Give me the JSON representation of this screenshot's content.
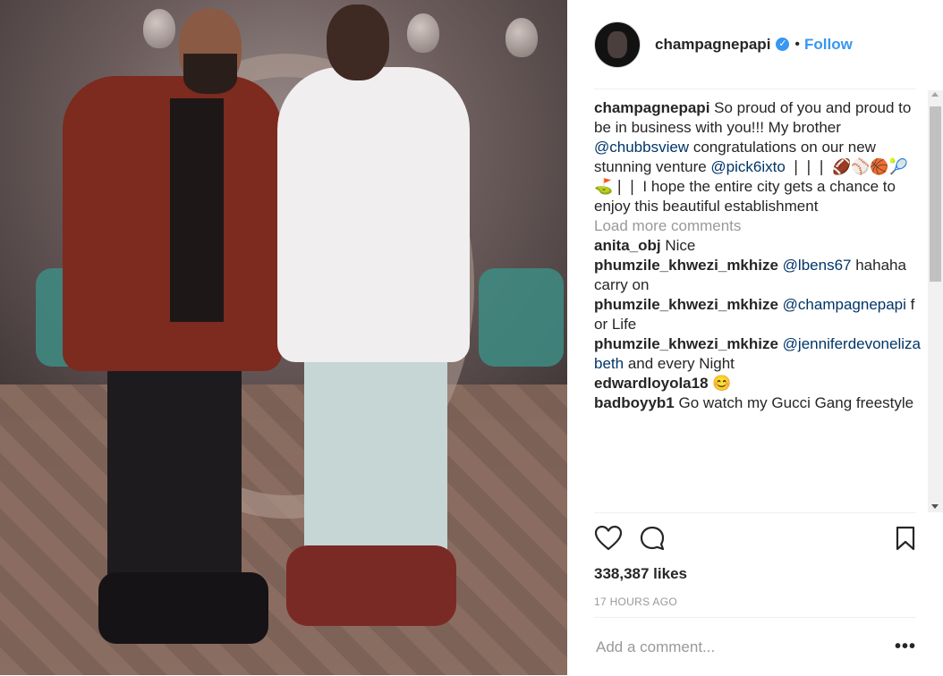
{
  "post": {
    "username": "champagnepapi",
    "verified_glyph": "✓",
    "separator": "•",
    "follow_label": "Follow",
    "caption": {
      "username": "champagnepapi",
      "text_1": " So proud of you and proud to be in business with you!!! My brother ",
      "mention_1": "@chubbsview",
      "text_2": " congratulations on our new stunning venture ",
      "mention_2": "@pick6ixto",
      "text_3": " ❘❘❘ 🏈⚾🏀🎾⛳❘❘ I hope the entire city gets a chance to enjoy this beautiful establishment"
    },
    "load_more_label": "Load more comments",
    "comments": [
      {
        "user": "anita_obj",
        "mention": "",
        "text": " Nice"
      },
      {
        "user": "phumzile_khwezi_mkhize",
        "mention": " @lbens67",
        "text": " hahaha carry on"
      },
      {
        "user": "phumzile_khwezi_mkhize",
        "mention": " @champagnepapi",
        "text": " for Life"
      },
      {
        "user": "phumzile_khwezi_mkhize",
        "mention": " @jenniferdevonelizabeth",
        "text": " and every Night"
      },
      {
        "user": "edwardloyola18",
        "mention": "",
        "text": " 😊"
      },
      {
        "user": "badboyyb1",
        "mention": "",
        "text": " Go watch my Gucci Gang freestyle"
      }
    ],
    "likes": "338,387 likes",
    "timestamp": "17 HOURS AGO",
    "add_comment_placeholder": "Add a comment...",
    "more_label": "•••"
  },
  "icons": {
    "like": "heart-icon",
    "comment": "comment-bubble-icon",
    "save": "bookmark-icon",
    "verified": "verified-badge-icon"
  },
  "colors": {
    "link": "#3897f0",
    "mention": "#003569",
    "muted": "#999999",
    "text": "#262626"
  }
}
